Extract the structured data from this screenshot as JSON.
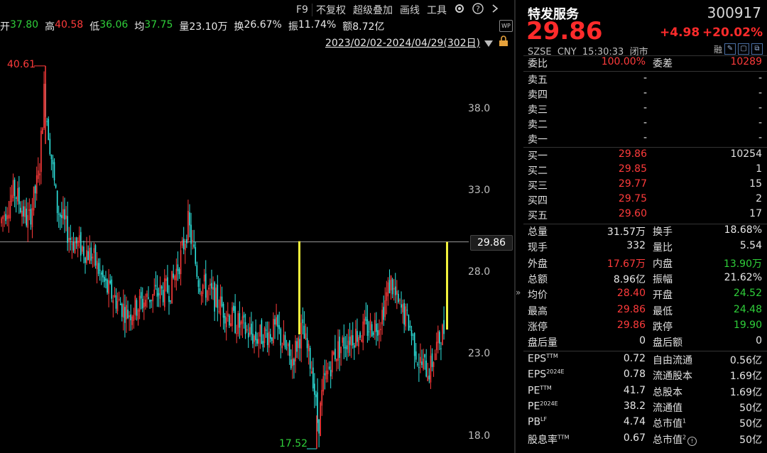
{
  "toolbar": {
    "items": [
      "F9",
      "不复权",
      "超级叠加",
      "画线",
      "工具"
    ],
    "gear_icon": "gear-icon",
    "help_icon": "help-icon",
    "arrow_icon": "chevron-right-icon"
  },
  "stats": {
    "open_label": "开",
    "open_value": "37.80",
    "high_label": "高",
    "high_value": "40.58",
    "low_label": "低",
    "low_value": "36.06",
    "avg_label": "均",
    "avg_value": "37.75",
    "vol_label": "量",
    "vol_value": "23.10万",
    "turn_label": "换",
    "turn_value": "26.67%",
    "amp_label": "振",
    "amp_value": "11.74%",
    "amt_label": "额",
    "amt_value": "8.72亿"
  },
  "range_text": "2023/02/02-2024/04/29(302日)",
  "y_axis": [
    "38.0",
    "33.0",
    "28.0",
    "23.0",
    "18.0"
  ],
  "current_price_tag": "29.86",
  "high_marker": "40.61",
  "low_marker": "17.52",
  "chart_data": {
    "type": "candlestick",
    "y_ticks": [
      38.0,
      33.0,
      28.0,
      23.0,
      18.0
    ],
    "ylim": [
      16.5,
      41.8
    ],
    "max_label": 40.61,
    "min_label": 17.52,
    "last_price": 29.86,
    "colors": {
      "up": "#ff3b3b",
      "down": "#2ee6e0",
      "limit": "#f2f23c"
    }
  },
  "quote": {
    "name": "特发服务",
    "code": "300917",
    "price": "29.86",
    "change": "+4.98",
    "change_pct": "+20.02%",
    "exchange": "SZSE",
    "currency": "CNY",
    "time": "15:30:33",
    "status": "闭市",
    "tag": "融",
    "weibi_label": "委比",
    "weibi_value": "100.00%",
    "weicha_label": "委差",
    "weicha_value": "10289",
    "sell": [
      {
        "label": "卖五",
        "price": "-",
        "vol": "-"
      },
      {
        "label": "卖四",
        "price": "-",
        "vol": "-"
      },
      {
        "label": "卖三",
        "price": "-",
        "vol": "-"
      },
      {
        "label": "卖二",
        "price": "-",
        "vol": "-"
      },
      {
        "label": "卖一",
        "price": "-",
        "vol": "-"
      }
    ],
    "buy": [
      {
        "label": "买一",
        "price": "29.86",
        "vol": "10254"
      },
      {
        "label": "买二",
        "price": "29.85",
        "vol": "1"
      },
      {
        "label": "买三",
        "price": "29.77",
        "vol": "15"
      },
      {
        "label": "买四",
        "price": "29.75",
        "vol": "2"
      },
      {
        "label": "买五",
        "price": "29.60",
        "vol": "17"
      }
    ],
    "details": [
      {
        "l1": "总量",
        "v1": "31.57万",
        "c1": "white",
        "l2": "换手",
        "v2": "18.68%",
        "c2": "white"
      },
      {
        "l1": "现手",
        "v1": "332",
        "c1": "white",
        "l2": "量比",
        "v2": "5.54",
        "c2": "white"
      },
      {
        "l1": "外盘",
        "v1": "17.67万",
        "c1": "red",
        "l2": "内盘",
        "v2": "13.90万",
        "c2": "green"
      },
      {
        "l1": "总额",
        "v1": "8.96亿",
        "c1": "white",
        "l2": "振幅",
        "v2": "21.62%",
        "c2": "white"
      },
      {
        "l1": "均价",
        "v1": "28.40",
        "c1": "red",
        "l2": "开盘",
        "v2": "24.52",
        "c2": "green"
      },
      {
        "l1": "最高",
        "v1": "29.86",
        "c1": "red",
        "l2": "最低",
        "v2": "24.48",
        "c2": "green"
      },
      {
        "l1": "涨停",
        "v1": "29.86",
        "c1": "red",
        "l2": "跌停",
        "v2": "19.90",
        "c2": "green"
      },
      {
        "l1": "盘后量",
        "v1": "0",
        "c1": "white",
        "l2": "盘后额",
        "v2": "0",
        "c2": "white"
      }
    ],
    "fundamentals": [
      {
        "l1": "EPS",
        "s1": "TTM",
        "v1": "0.72",
        "l2": "自由流通",
        "v2": "0.56亿"
      },
      {
        "l1": "EPS",
        "s1": "2024E",
        "v1": "0.78",
        "l2": "流通股本",
        "v2": "1.69亿"
      },
      {
        "l1": "PE",
        "s1": "TTM",
        "v1": "41.7",
        "l2": "总股本",
        "v2": "1.69亿"
      },
      {
        "l1": "PE",
        "s1": "2024E",
        "v1": "38.2",
        "l2": "流通值",
        "v2": "50亿"
      },
      {
        "l1": "PB",
        "s1": "LF",
        "v1": "4.74",
        "l2": "总市值",
        "s2": "1",
        "v2": "50亿"
      },
      {
        "l1": "股息率",
        "s1": "TTM",
        "v1": "0.67",
        "l2": "总市值",
        "s2": "2",
        "v2": "50亿"
      }
    ]
  }
}
